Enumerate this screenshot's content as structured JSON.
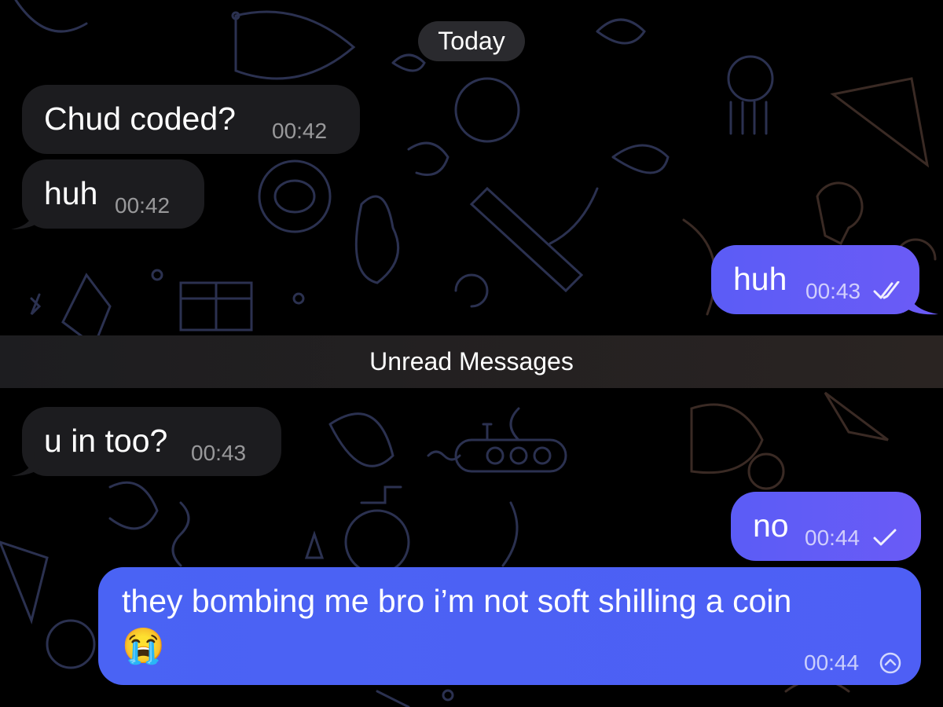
{
  "chat": {
    "date_chip": "Today",
    "unread_divider": "Unread Messages",
    "messages": [
      {
        "direction": "incoming",
        "text": "Chud coded?",
        "time": "00:42"
      },
      {
        "direction": "incoming",
        "text": "huh",
        "time": "00:42"
      },
      {
        "direction": "outgoing",
        "text": "huh",
        "time": "00:43",
        "status": "read-double-check-icon"
      },
      {
        "direction": "incoming",
        "text": "u in too?",
        "time": "00:43"
      },
      {
        "direction": "outgoing",
        "text": "no",
        "time": "00:44",
        "status": "sent-check-icon"
      },
      {
        "direction": "outgoing",
        "text": "they bombing me bro i’m not soft shilling a coin",
        "emoji": "😭",
        "time": "00:44",
        "status": "sending-clock-icon"
      }
    ]
  },
  "colors": {
    "background": "#000000",
    "incoming_bubble": "#1c1c1f",
    "outgoing_bubble": "#5b5cf6",
    "outgoing_bubble_last": "#4a63f4",
    "wallpaper_doodle": "#2b3150"
  }
}
